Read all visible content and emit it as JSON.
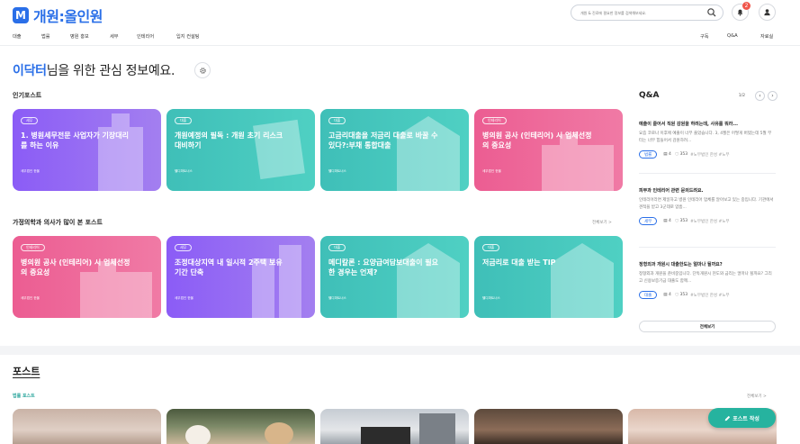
{
  "header": {
    "logo_mark": "M",
    "logo_text": "개원:올인원",
    "search_placeholder": "개원 & 진료에 필요한 정보를 검색해보세요.",
    "notification_count": "2"
  },
  "nav": {
    "left": [
      "대출",
      "법률",
      "병원 홍보",
      "세무",
      "인테리어",
      "입지 컨설팅"
    ],
    "right": [
      "구독",
      "Q&A",
      "자료실"
    ]
  },
  "greeting": {
    "name": "이닥터",
    "suffix": "님을 위한 관심 정보예요."
  },
  "popular": {
    "title": "인기포스트",
    "cards": [
      {
        "tag": "세무",
        "title": "1. 병원세무전문 사업자가 기장대리를 하는 이유",
        "author": "세무법인 한울"
      },
      {
        "tag": "대출",
        "title": "개원예정의 필독 : 개원 초기 리스크 대비하기",
        "author": "헬디파트너스"
      },
      {
        "tag": "대출",
        "title": "고금리대출을 저금리 대출로 바꿀 수 있다?:부채 통합대출",
        "author": "헬디파트너스"
      },
      {
        "tag": "인테리어",
        "title": "병의원 공사 (인테리어) 시 업체선정의 중요성",
        "author": "세무법인 한울"
      }
    ]
  },
  "specialty": {
    "title": "가정의학과 의사가 많이 본 포스트",
    "more": "전체보기 >",
    "cards": [
      {
        "tag": "인테리어",
        "title": "병의원 공사 (인테리어) 시 업체선정의 중요성",
        "author": "세무법인 한울"
      },
      {
        "tag": "세무",
        "title": "조정대상지역 내 일시적 2주택 보유 기간 단축",
        "author": "세무법인 한울"
      },
      {
        "tag": "대출",
        "title": "메디칼론 : 요양급여담보대출이 필요한 경우는 언제?",
        "author": "헬디파트너스"
      },
      {
        "tag": "대출",
        "title": "저금리로 대출 받는 TIP",
        "author": "헬디파트너스"
      }
    ]
  },
  "qa": {
    "title": "Q&A",
    "pager": "1/2",
    "items": [
      {
        "question": "예출이 줄어서 직원 감원을 하려는데, 사유를 뭐라...",
        "body": "요즘 코로나 이후에 예출이 너무 줄었습니다. 3, 4월은 어떻게 버텼는데 5월 부터는 너무 힘들어서 감원하려...",
        "chip": "법률",
        "comments": "4",
        "views": "353",
        "tags": "#노무법인 한성 #노무"
      },
      {
        "question": "피부과 인테리어 관련 문의드려요.",
        "body": "인테리어라면 제일하고 병원 인테리어 업체를 알아보고 있는 중입니다. 기관에서 견적을 받고 3군데로 압흡...",
        "chip": "세무",
        "comments": "4",
        "views": "353",
        "tags": "#노무법인 한성 #노무"
      },
      {
        "question": "정형외과 개원시 대출한도는 얼마나 될까요?",
        "body": "정형외과 개원을 준비중입니다. 단독개원시 현도와 금리는 얼마나 될까요? 그리고 신용보증기금 대출도 함께...",
        "chip": "대출",
        "comments": "4",
        "views": "353",
        "tags": "#노무법인 한성 #노무"
      }
    ],
    "all_label": "전체보기"
  },
  "posts": {
    "title": "포스트",
    "subtitle": "법률 포스트",
    "more": "전체보기 >"
  },
  "fab_label": "포스트 작성"
}
